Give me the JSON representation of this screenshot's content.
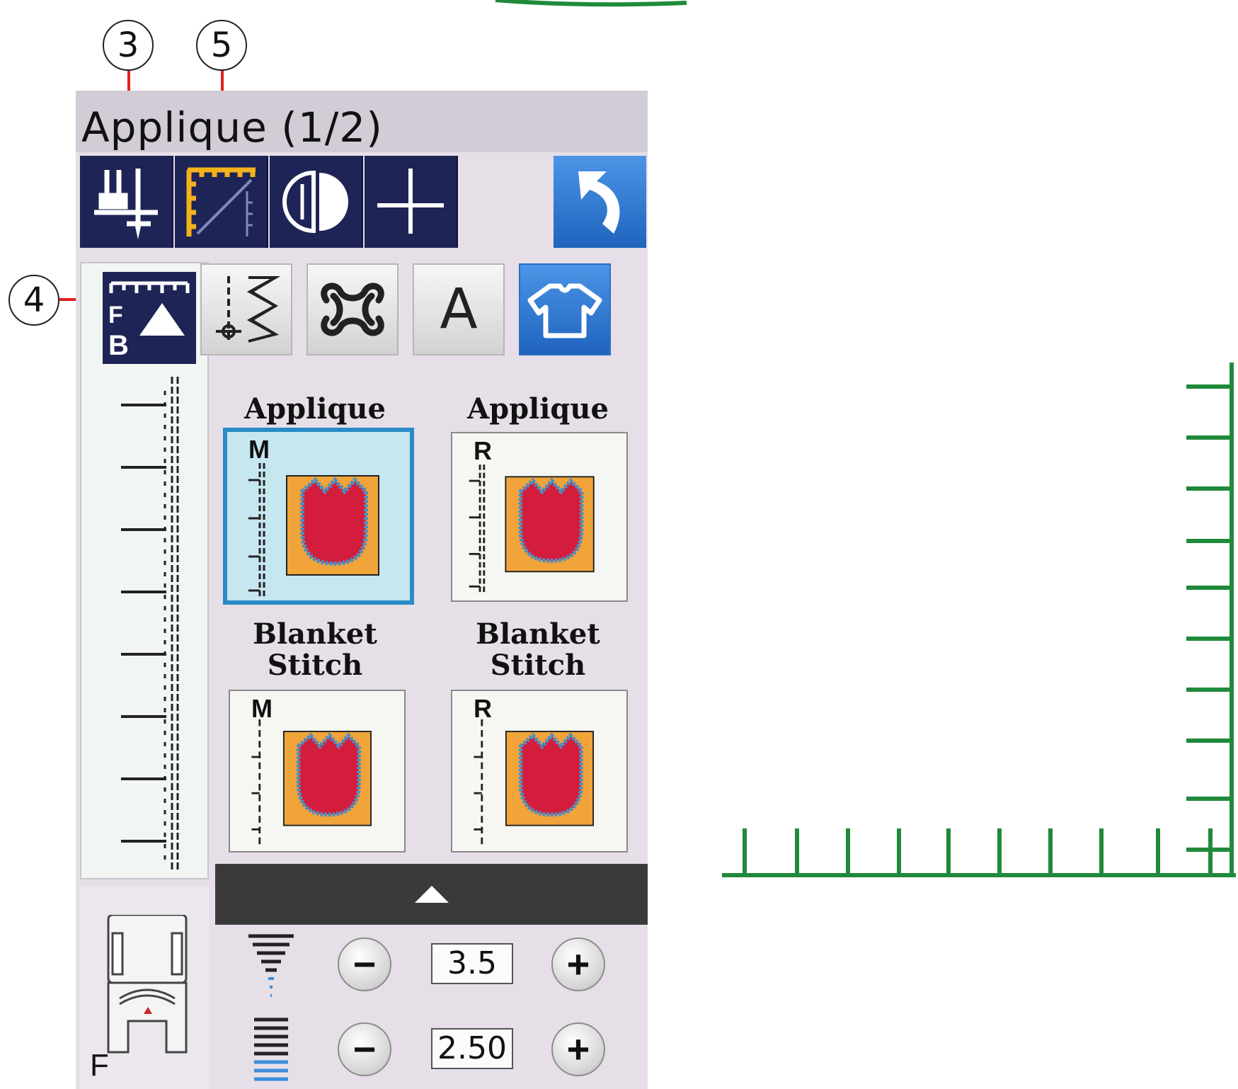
{
  "callouts": {
    "c3": "3",
    "c5": "5",
    "c4": "4"
  },
  "screen": {
    "title": "Applique (1/2)",
    "toolbar": [
      {
        "name": "presser-foot-needle",
        "icon": "presser-foot-icon"
      },
      {
        "name": "stitch-guide",
        "icon": "ruler-diagonal-icon",
        "highlight": "#f3b21b"
      },
      {
        "name": "mirror",
        "icon": "mirror-icon"
      },
      {
        "name": "needle-position",
        "icon": "needle-cross-icon"
      }
    ],
    "return_icon": "return-arrow-icon",
    "fb_label": {
      "top": "F",
      "bottom": "B"
    },
    "categories": [
      {
        "name": "utility",
        "icon": "utility-stitch-icon"
      },
      {
        "name": "decorative",
        "icon": "decorative-stitch-icon"
      },
      {
        "name": "letters",
        "label": "A"
      },
      {
        "name": "garment",
        "icon": "shirt-icon",
        "active": true
      }
    ],
    "stitches": [
      {
        "label": "Applique",
        "letter": "M",
        "selected": true
      },
      {
        "label": "Applique",
        "letter": "R",
        "selected": false
      },
      {
        "label": "Blanket\nStitch",
        "letter": "M",
        "selected": false
      },
      {
        "label": "Blanket\nStitch",
        "letter": "R",
        "selected": false
      }
    ],
    "foot_label": "F",
    "width_value": "3.5",
    "length_value": "2.50",
    "minus_label": "−",
    "plus_label": "+"
  },
  "colors": {
    "accent": "#1e2456",
    "highlight": "#f3b21b",
    "ruler": "#1f8a3a",
    "leader": "#e02020"
  }
}
